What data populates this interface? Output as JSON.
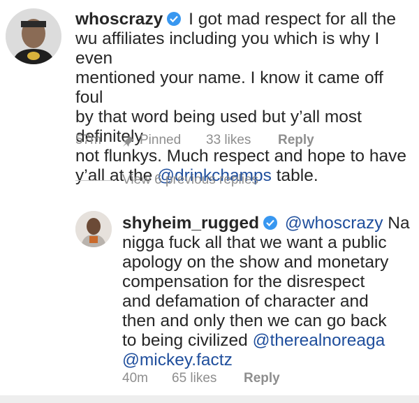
{
  "comment1": {
    "username": "whoscrazy",
    "text_lines": [
      "I got mad respect for all the",
      "wu affiliates including you which is why I even",
      "mentioned your name. I know it came off foul",
      "by that word being used but y’all most definitely",
      "not flunkys. Much respect and hope to have"
    ],
    "last_line_prefix": "y’all at the ",
    "mention": "@drinkchamps",
    "last_line_suffix": " table.",
    "time": "57m",
    "pinned_label": "Pinned",
    "likes": "33 likes",
    "reply_label": "Reply"
  },
  "view_replies": "View 6 previous replies",
  "comment2": {
    "username": "shyheim_rugged",
    "mention_first": "@whoscrazy",
    "first_line_rest": " Na",
    "text_lines": [
      "nigga fuck all that we want a public",
      "apology on the show and monetary",
      "compensation for the disrespect",
      "and defamation of character and",
      "then and only then we can go back"
    ],
    "line7_prefix": "to being civilized ",
    "mention_second": "@therealnoreaga",
    "mention_third": "@mickey.factz",
    "time": "40m",
    "likes": "65 likes",
    "reply_label": "Reply"
  },
  "colors": {
    "verified": "#3897f0",
    "mention": "#1f4e9c",
    "meta": "#8e8e8e"
  },
  "icons": [
    "verified-badge-icon",
    "pin-icon"
  ]
}
